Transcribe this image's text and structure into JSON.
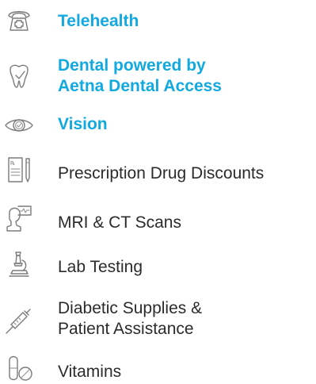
{
  "benefits": [
    {
      "label": "Telehealth",
      "highlight": true,
      "icon": "telephone-medical-icon"
    },
    {
      "label_lines": [
        "Dental powered by",
        "Aetna Dental Access"
      ],
      "highlight": true,
      "icon": "tooth-icon"
    },
    {
      "label": "Vision",
      "highlight": true,
      "icon": "eye-icon"
    },
    {
      "label": "Prescription Drug Discounts",
      "highlight": false,
      "icon": "prescription-icon"
    },
    {
      "label": "MRI & CT Scans",
      "highlight": false,
      "icon": "mri-scan-icon"
    },
    {
      "label": "Lab Testing",
      "highlight": false,
      "icon": "microscope-icon"
    },
    {
      "label_lines": [
        "Diabetic Supplies &",
        "Patient Assistance"
      ],
      "highlight": false,
      "icon": "syringe-icon"
    },
    {
      "label": "Vitamins",
      "highlight": false,
      "icon": "pills-icon"
    }
  ],
  "colors": {
    "highlight": "#12a9e0",
    "text": "#2b2b2b",
    "icon": "#7b7b7b"
  }
}
